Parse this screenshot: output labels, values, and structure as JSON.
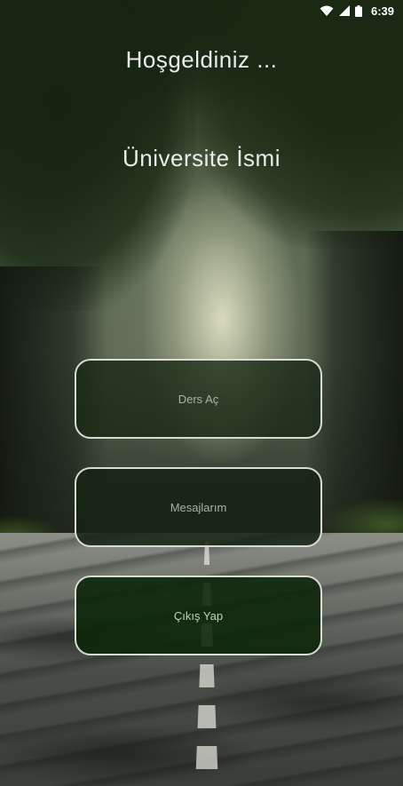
{
  "status_bar": {
    "time": "6:39",
    "icons": [
      "wifi-icon",
      "signal-icon",
      "battery-icon"
    ]
  },
  "header": {
    "welcome": "Hoşgeldiniz ...",
    "university_name": "Üniversite İsmi"
  },
  "menu": {
    "buttons": [
      {
        "label": "Ders Aç"
      },
      {
        "label": "Mesajlarım"
      },
      {
        "label": "Çıkış Yap"
      }
    ]
  },
  "colors": {
    "button_border": "#d7dcd6",
    "button_text": "#aab2aa",
    "title_text": "#e9ecea"
  }
}
